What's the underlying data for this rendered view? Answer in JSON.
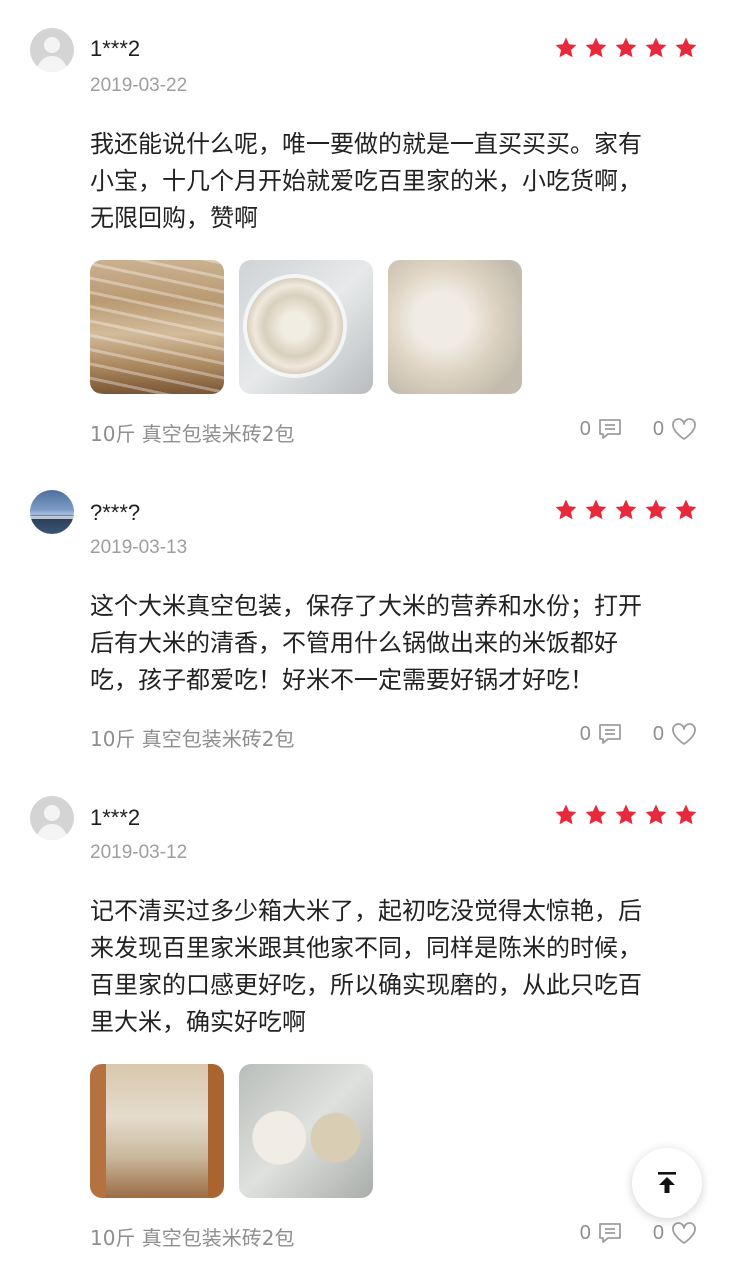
{
  "colors": {
    "star": "#e8283b",
    "muted": "#9e9e9e",
    "text": "#222222"
  },
  "reviews": [
    {
      "username": "1***2",
      "date": "2019-03-22",
      "rating": 5,
      "avatar": "default-user-icon",
      "content": "我还能说什么呢，唯一要做的就是一直买买买。家有\n小宝，十几个月开始就爱吃百里家的米，小吃货啊，\n无限回购，赞啊",
      "images": [
        "rice-bags-photo",
        "rice-bowl-photo",
        "rice-bag-closeup-photo"
      ],
      "spec": "10斤 真空包装米砖2包",
      "comment_count": "0",
      "like_count": "0"
    },
    {
      "username": "?***?",
      "date": "2019-03-13",
      "rating": 5,
      "avatar": "landscape-avatar",
      "content": "这个大米真空包装，保存了大米的营养和水份；打开\n后有大米的清香，不管用什么锅做出来的米饭都好\n吃，孩子都爱吃！好米不一定需要好锅才好吃！",
      "images": [],
      "spec": "10斤 真空包装米砖2包",
      "comment_count": "0",
      "like_count": "0"
    },
    {
      "username": "1***2",
      "date": "2019-03-12",
      "rating": 5,
      "avatar": "default-user-icon",
      "content": "记不清买过多少箱大米了，起初吃没觉得太惊艳，后\n来发现百里家米跟其他家不同，同样是陈米的时候，\n百里家的口感更好吃，所以确实现磨的，从此只吃百\n里大米，确实好吃啊",
      "images": [
        "rice-box-photo",
        "rice-comparison-photo"
      ],
      "spec": "10斤 真空包装米砖2包",
      "comment_count": "0",
      "like_count": "0"
    }
  ],
  "back_to_top": "arrow-up-to-top-icon"
}
